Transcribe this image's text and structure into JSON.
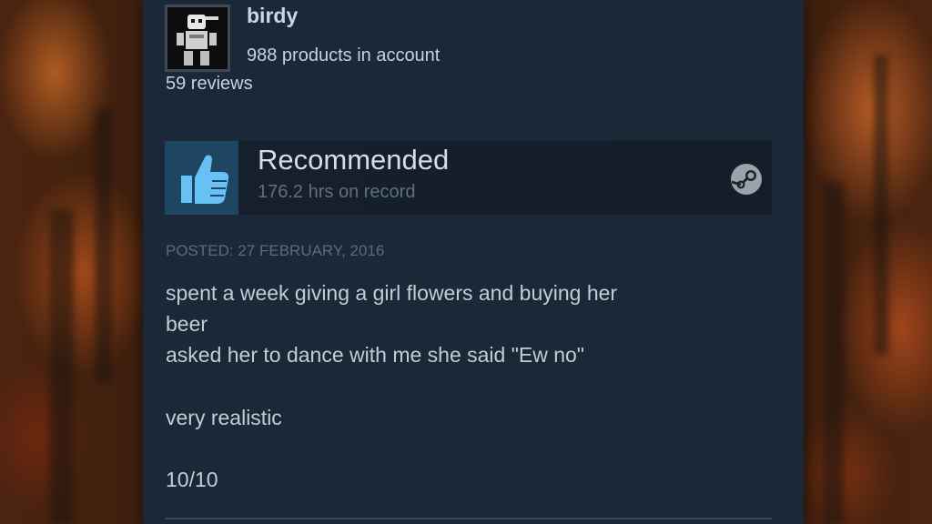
{
  "user": {
    "name": "birdy",
    "products": "988 products in account",
    "reviews": "59 reviews"
  },
  "review": {
    "verdict": "Recommended",
    "hours": "176.2 hrs on record",
    "posted": "POSTED: 27 FEBRUARY, 2016",
    "lines": [
      "spent a week giving a girl flowers and buying her",
      "beer",
      "asked her to dance with me she said \"Ew no\"",
      "very realistic",
      "10/10"
    ]
  },
  "icons": {
    "verdict_icon": "thumbs-up-icon",
    "platform_icon": "steam-icon"
  },
  "colors": {
    "panel": "#1b2838",
    "thumb_bg": "#1e4562",
    "thumb": "#67c1f5"
  }
}
